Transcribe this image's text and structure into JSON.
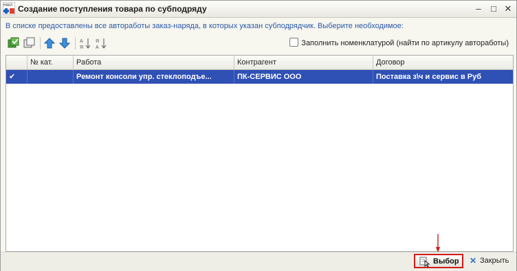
{
  "window": {
    "title": "Создание поступления товара по субподряду",
    "app_icon_text": "НАКЛ",
    "minimize_glyph": "–",
    "maximize_glyph": "□",
    "close_glyph": "✕"
  },
  "hint": "В списке предоставлены все автоработы заказ-наряда, в которых указан субподрядчик. Выберите необходимое:",
  "toolbar": {
    "fill_nomenclature_label": "Заполнить номенклатурой (найти по артикулу автоработы)",
    "fill_nomenclature_checked": false,
    "icons": [
      "check-all-icon",
      "uncheck-all-icon",
      "move-up-icon",
      "move-down-icon",
      "sort-ascending-icon",
      "sort-descending-icon"
    ]
  },
  "table": {
    "columns": [
      "",
      "№ кат.",
      "Работа",
      "Контрагент",
      "Договор"
    ],
    "rows": [
      {
        "checked": true,
        "checkmark": "✔",
        "cat_no": "",
        "work": "Ремонт консоли упр. стеклоподъе...",
        "contractor": "ПК-СЕРВИС ООО",
        "contract": "Поставка з\\ч и сервис в Руб"
      }
    ]
  },
  "footer": {
    "select_label": "Выбор",
    "close_label": "Закрыть"
  },
  "colors": {
    "selection": "#2f50b5",
    "hint_text": "#2a57a8",
    "highlight_border": "#d21a1a"
  }
}
